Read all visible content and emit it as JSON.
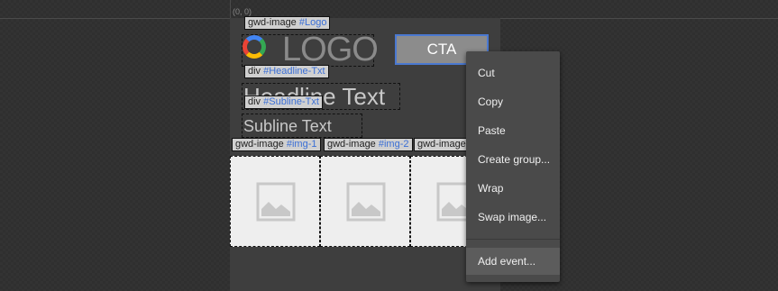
{
  "canvas": {
    "origin_label": "(0, 0)"
  },
  "ad": {
    "logo_text": "LOGO",
    "cta_label": "CTA",
    "headline": "Headline Text",
    "subline": "Subline Text"
  },
  "tags": {
    "logo": {
      "type": "gwd-image",
      "id": "#Logo"
    },
    "headline": {
      "type": "div",
      "id": "#Headline-Txt"
    },
    "subline": {
      "type": "div",
      "id": "#Subline-Txt"
    },
    "img1": {
      "type": "gwd-image",
      "id": "#img-1"
    },
    "img2": {
      "type": "gwd-image",
      "id": "#img-2"
    },
    "img3": {
      "type": "gwd-image",
      "id": ""
    }
  },
  "context_menu": {
    "items": [
      "Cut",
      "Copy",
      "Paste",
      "Create group...",
      "Wrap",
      "Swap image...",
      "Add event..."
    ]
  },
  "icons": {
    "image_placeholder": "image-placeholder-icon",
    "logo_mark": "ring-logo-icon"
  }
}
